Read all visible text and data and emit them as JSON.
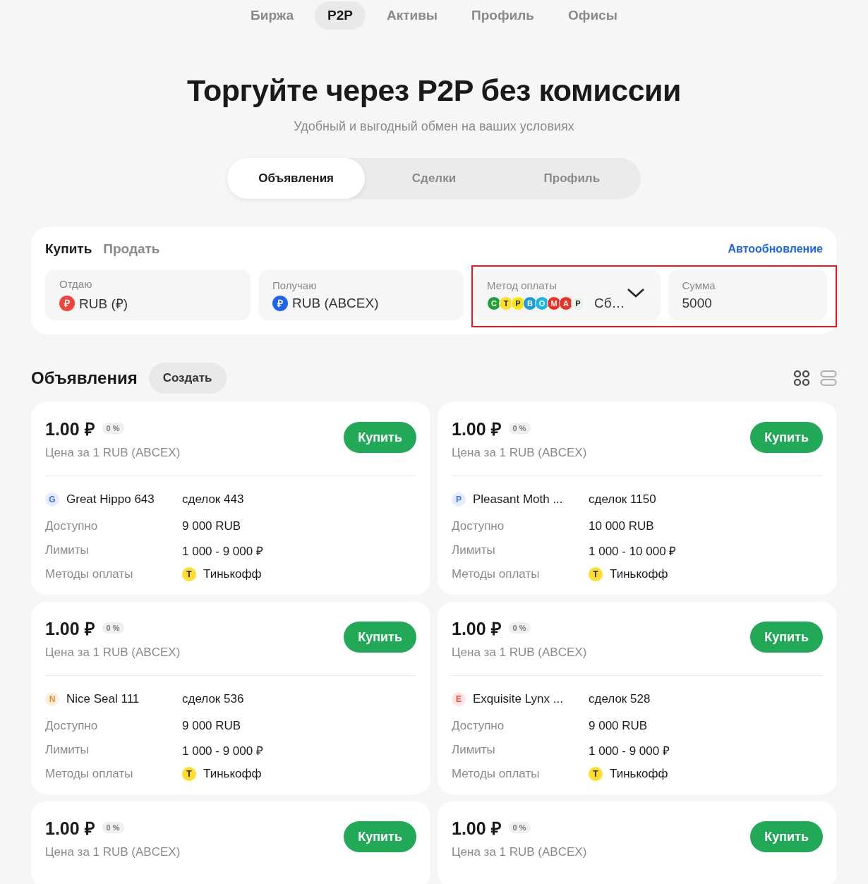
{
  "top_nav": [
    {
      "label": "Биржа",
      "selected": false
    },
    {
      "label": "P2P",
      "selected": true
    },
    {
      "label": "Активы",
      "selected": false
    },
    {
      "label": "Профиль",
      "selected": false
    },
    {
      "label": "Офисы",
      "selected": false
    }
  ],
  "hero": {
    "title": "Торгуйте через P2P без комиссии",
    "subtitle": "Удобный и выгодный обмен на ваших условиях"
  },
  "segments": [
    {
      "label": "Объявления",
      "selected": true
    },
    {
      "label": "Сделки",
      "selected": false
    },
    {
      "label": "Профиль",
      "selected": false
    }
  ],
  "filters": {
    "sides": [
      {
        "label": "Купить",
        "selected": true
      },
      {
        "label": "Продать",
        "selected": false
      }
    ],
    "auto_refresh": "Автообновление",
    "fields": [
      {
        "kind": "currency",
        "label": "Отдаю",
        "logo": {
          "letter": "₽",
          "color": "#f04438"
        },
        "value": "RUB (₽)"
      },
      {
        "kind": "currency",
        "label": "Получаю",
        "logo": {
          "letter": "₽",
          "color": "#1d64f2"
        },
        "value": "RUB (ABCEX)"
      }
    ],
    "highlighted_fields": [
      {
        "kind": "payment",
        "label": "Метод оплаты",
        "logos": [
          {
            "letter": "C",
            "color": "#21a038"
          },
          {
            "letter": "T",
            "color": "#ffdd2d"
          },
          {
            "letter": "P",
            "color": "#fee600"
          },
          {
            "letter": "B",
            "color": "#1e9ad6"
          },
          {
            "letter": "O",
            "color": "#1cb6e8"
          },
          {
            "letter": "M",
            "color": "#ef3124"
          },
          {
            "letter": "A",
            "color": "#ef3124"
          },
          {
            "letter": "P",
            "color": "#e9f5ea"
          }
        ],
        "value": "Сб…"
      },
      {
        "kind": "amount",
        "label": "Сумма",
        "value": "5000"
      }
    ]
  },
  "listings": {
    "title": "Объявления",
    "create": "Создать",
    "view_modes": [
      {
        "kind": "grid",
        "selected": true
      },
      {
        "kind": "list",
        "selected": false
      }
    ]
  },
  "offers": [
    {
      "price": "1.00 ₽",
      "fee": "0 %",
      "subtitle": "Цена за 1 RUB (ABCEX)",
      "action": "Купить",
      "seller": {
        "letter": "G",
        "name": "Great Hippo 643",
        "color": "#3b6ff5"
      },
      "deals": "сделок 443",
      "details": [
        {
          "label": "Доступно",
          "value": "9 000 RUB"
        },
        {
          "label": "Лимиты",
          "value": "1 000 - 9 000 ₽"
        }
      ],
      "payment_label": "Методы оплаты",
      "payment_methods": [
        {
          "letter": "T",
          "name": "Тинькофф",
          "color": "#ffdd2d"
        }
      ]
    },
    {
      "price": "1.00 ₽",
      "fee": "0 %",
      "subtitle": "Цена за 1 RUB (ABCEX)",
      "action": "Купить",
      "seller": {
        "letter": "P",
        "name": "Pleasant Moth ...",
        "color": "#3b6ff5"
      },
      "deals": "сделок 1150",
      "details": [
        {
          "label": "Доступно",
          "value": "10 000 RUB"
        },
        {
          "label": "Лимиты",
          "value": "1 000 - 10 000 ₽"
        }
      ],
      "payment_label": "Методы оплаты",
      "payment_methods": [
        {
          "letter": "T",
          "name": "Тинькофф",
          "color": "#ffdd2d"
        }
      ]
    },
    {
      "price": "1.00 ₽",
      "fee": "0 %",
      "subtitle": "Цена за 1 RUB (ABCEX)",
      "action": "Купить",
      "seller": {
        "letter": "N",
        "name": "Nice Seal 111",
        "color": "#f08a24"
      },
      "deals": "сделок 536",
      "details": [
        {
          "label": "Доступно",
          "value": "9 000 RUB"
        },
        {
          "label": "Лимиты",
          "value": "1 000 - 9 000 ₽"
        }
      ],
      "payment_label": "Методы оплаты",
      "payment_methods": [
        {
          "letter": "T",
          "name": "Тинькофф",
          "color": "#ffdd2d"
        }
      ]
    },
    {
      "price": "1.00 ₽",
      "fee": "0 %",
      "subtitle": "Цена за 1 RUB (ABCEX)",
      "action": "Купить",
      "seller": {
        "letter": "E",
        "name": "Exquisite Lynx ...",
        "color": "#f04438"
      },
      "deals": "сделок 528",
      "details": [
        {
          "label": "Доступно",
          "value": "9 000 RUB"
        },
        {
          "label": "Лимиты",
          "value": "1 000 - 9 000 ₽"
        }
      ],
      "payment_label": "Методы оплаты",
      "payment_methods": [
        {
          "letter": "T",
          "name": "Тинькофф",
          "color": "#ffdd2d"
        }
      ]
    },
    {
      "price": "1.00 ₽",
      "fee": "0 %",
      "subtitle": "Цена за 1 RUB (ABCEX)",
      "action": "Купить"
    },
    {
      "price": "1.00 ₽",
      "fee": "0 %",
      "subtitle": "Цена за 1 RUB (ABCEX)",
      "action": "Купить"
    }
  ]
}
